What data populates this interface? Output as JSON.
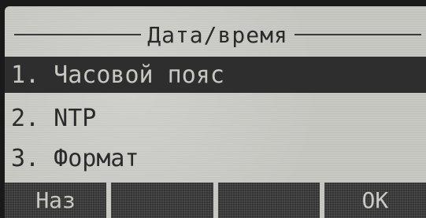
{
  "screen": {
    "title": "Дата/время"
  },
  "menu": {
    "items": [
      {
        "label": "1. Часовой пояс",
        "selected": true
      },
      {
        "label": "2. NTP",
        "selected": false
      },
      {
        "label": "3. Формат",
        "selected": false
      }
    ]
  },
  "softkeys": {
    "k1": "Наз",
    "k2": "",
    "k3": "",
    "k4": "OK"
  }
}
